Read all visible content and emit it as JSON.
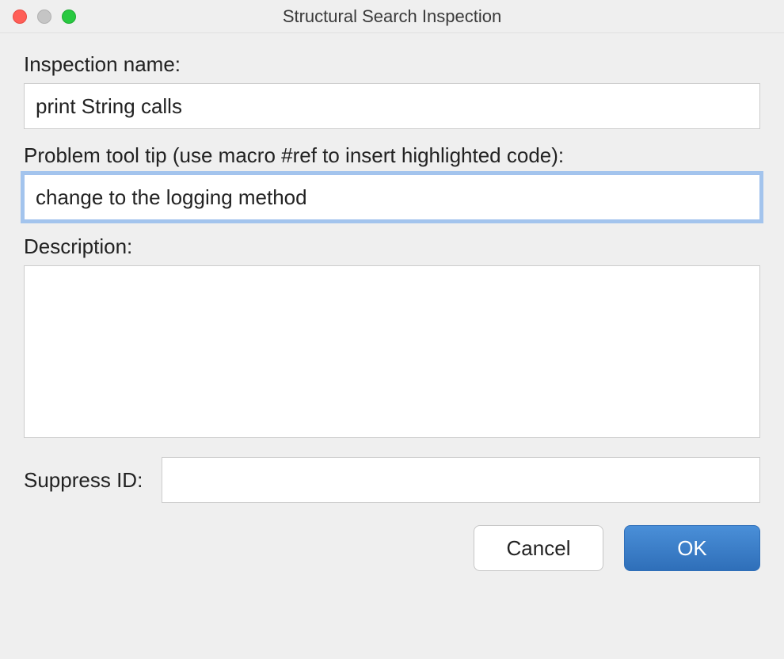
{
  "window": {
    "title": "Structural Search Inspection"
  },
  "form": {
    "inspection_name_label": "Inspection name:",
    "inspection_name_value": "print String calls",
    "problem_tooltip_label": "Problem tool tip (use macro #ref to insert highlighted code):",
    "problem_tooltip_value": "change to the logging method",
    "description_label": "Description:",
    "description_value": "",
    "suppress_id_label": "Suppress ID:",
    "suppress_id_value": ""
  },
  "buttons": {
    "cancel": "Cancel",
    "ok": "OK"
  }
}
